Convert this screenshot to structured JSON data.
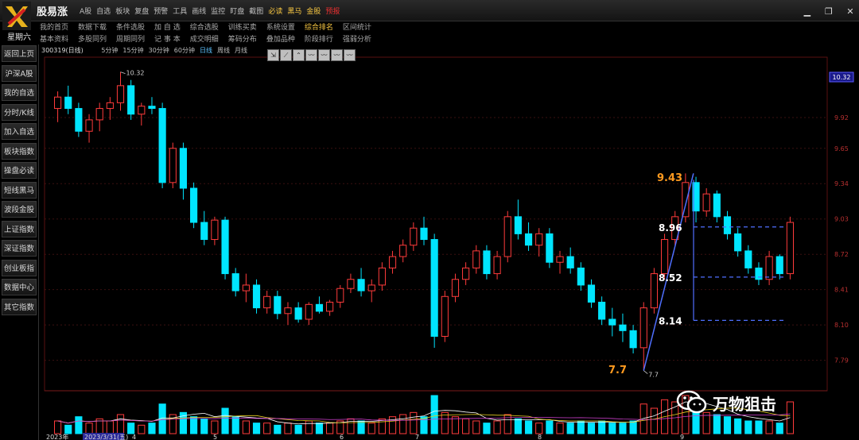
{
  "app": {
    "title": "股易涨",
    "top_menu": [
      "A股",
      "自选",
      "板块",
      "复盘",
      "预警",
      "工具",
      "画线",
      "监控",
      "盯盘",
      "截图",
      "必读",
      "黑马",
      "金股",
      "预报"
    ],
    "top_menu_colors": {
      "必读": "#f5c542",
      "黑马": "#f5c542",
      "金股": "#f5c542",
      "预报": "#e83030"
    },
    "weekday": "星期六",
    "nav_row1": [
      "我的首页",
      "数据下载",
      "条件选股",
      "加 自 选",
      "综合选股",
      "训练买卖",
      "系统设置",
      "综合排名",
      "区间统计"
    ],
    "nav_row2": [
      "基本资料",
      "多股同列",
      "周期同列",
      "记 事 本",
      "成交明细",
      "筹码分布",
      "叠加品种",
      "阶段排行",
      "强弱分析"
    ],
    "nav_highlight": "综合排名"
  },
  "sidebar": {
    "items": [
      "返回上页",
      "沪深A股",
      "我的自选",
      "分时/K线",
      "加入自选",
      "板块指数",
      "操盘必读",
      "短线黑马",
      "波段金股",
      "上证指数",
      "深证指数",
      "创业板指",
      "数据中心",
      "其它指数"
    ]
  },
  "chart_header": {
    "stock_code": "300319(日线)",
    "periods": [
      "5分钟",
      "15分钟",
      "30分钟",
      "60分钟",
      "日线",
      "周线",
      "月线"
    ],
    "active_period": "日线"
  },
  "tools": [
    "cursor-tool",
    "line-tool",
    "segment-tool",
    "wave-tool-1",
    "wave-tool-2",
    "wave-tool-3",
    "wave-tool-4"
  ],
  "watermark": {
    "text": "万物狙击",
    "icon": "wechat-icon"
  },
  "colors": {
    "up": "#ff3b3b",
    "down": "#00e5ff",
    "accent": "#ff9a1f",
    "annot": "#4f6fff",
    "grid": "#3a1010"
  },
  "chart_data": {
    "type": "candlestick",
    "y_axis": {
      "ticks": [
        "9.92",
        "9.65",
        "9.34",
        "9.03",
        "8.72",
        "8.41",
        "8.10",
        "7.79"
      ],
      "current_price": "10.32",
      "range": [
        7.62,
        10.45
      ]
    },
    "x_axis": {
      "labels": [
        "2023年",
        "2023/3/31(五)",
        "4",
        "5",
        "6",
        "7",
        "8",
        "9"
      ]
    },
    "annotations": {
      "high_label": "10.32",
      "low_label": "7.7",
      "low_big": "7.7",
      "target_top": "9.43",
      "levels": [
        "8.96",
        "8.52",
        "8.14"
      ]
    },
    "ohlc": [
      [
        10.0,
        10.15,
        9.88,
        10.1
      ],
      [
        10.1,
        10.2,
        9.95,
        10.0
      ],
      [
        10.0,
        10.05,
        9.75,
        9.8
      ],
      [
        9.8,
        9.95,
        9.7,
        9.9
      ],
      [
        9.9,
        10.05,
        9.8,
        10.0
      ],
      [
        10.0,
        10.1,
        9.9,
        10.05
      ],
      [
        10.05,
        10.32,
        9.98,
        10.2
      ],
      [
        10.2,
        10.25,
        9.9,
        9.95
      ],
      [
        9.95,
        10.05,
        9.85,
        10.02
      ],
      [
        10.02,
        10.1,
        9.95,
        10.0
      ],
      [
        10.0,
        10.05,
        9.3,
        9.35
      ],
      [
        9.35,
        9.7,
        9.3,
        9.65
      ],
      [
        9.65,
        9.7,
        9.2,
        9.3
      ],
      [
        9.3,
        9.35,
        8.95,
        9.0
      ],
      [
        9.0,
        9.1,
        8.8,
        8.85
      ],
      [
        8.85,
        9.05,
        8.8,
        9.02
      ],
      [
        9.02,
        9.05,
        8.5,
        8.55
      ],
      [
        8.55,
        8.6,
        8.35,
        8.4
      ],
      [
        8.4,
        8.55,
        8.3,
        8.45
      ],
      [
        8.45,
        8.5,
        8.2,
        8.25
      ],
      [
        8.25,
        8.4,
        8.2,
        8.35
      ],
      [
        8.35,
        8.4,
        8.15,
        8.2
      ],
      [
        8.2,
        8.3,
        8.1,
        8.25
      ],
      [
        8.25,
        8.3,
        8.12,
        8.15
      ],
      [
        8.15,
        8.3,
        8.1,
        8.28
      ],
      [
        8.28,
        8.35,
        8.2,
        8.22
      ],
      [
        8.22,
        8.32,
        8.18,
        8.3
      ],
      [
        8.3,
        8.45,
        8.25,
        8.42
      ],
      [
        8.42,
        8.55,
        8.38,
        8.5
      ],
      [
        8.5,
        8.6,
        8.35,
        8.4
      ],
      [
        8.4,
        8.5,
        8.3,
        8.45
      ],
      [
        8.45,
        8.65,
        8.4,
        8.6
      ],
      [
        8.6,
        8.75,
        8.55,
        8.7
      ],
      [
        8.7,
        8.85,
        8.65,
        8.8
      ],
      [
        8.8,
        9.0,
        8.75,
        8.95
      ],
      [
        8.95,
        9.05,
        8.8,
        8.85
      ],
      [
        8.85,
        8.9,
        7.9,
        8.0
      ],
      [
        8.0,
        8.4,
        7.95,
        8.35
      ],
      [
        8.35,
        8.55,
        8.3,
        8.5
      ],
      [
        8.5,
        8.65,
        8.45,
        8.6
      ],
      [
        8.6,
        8.8,
        8.55,
        8.75
      ],
      [
        8.75,
        8.8,
        8.5,
        8.55
      ],
      [
        8.55,
        8.75,
        8.5,
        8.7
      ],
      [
        8.7,
        9.1,
        8.65,
        9.05
      ],
      [
        9.05,
        9.2,
        8.85,
        8.9
      ],
      [
        8.9,
        9.0,
        8.75,
        8.8
      ],
      [
        8.8,
        8.95,
        8.7,
        8.9
      ],
      [
        8.9,
        8.95,
        8.6,
        8.65
      ],
      [
        8.65,
        8.75,
        8.55,
        8.7
      ],
      [
        8.7,
        8.78,
        8.55,
        8.6
      ],
      [
        8.6,
        8.65,
        8.4,
        8.45
      ],
      [
        8.45,
        8.5,
        8.25,
        8.3
      ],
      [
        8.3,
        8.35,
        8.1,
        8.15
      ],
      [
        8.15,
        8.25,
        8.0,
        8.1
      ],
      [
        8.1,
        8.2,
        7.95,
        8.05
      ],
      [
        8.05,
        8.1,
        7.85,
        7.9
      ],
      [
        7.9,
        8.3,
        7.7,
        8.25
      ],
      [
        8.25,
        8.6,
        8.2,
        8.55
      ],
      [
        8.55,
        8.9,
        8.5,
        8.85
      ],
      [
        8.85,
        9.1,
        8.8,
        9.05
      ],
      [
        9.05,
        9.43,
        9.0,
        9.35
      ],
      [
        9.35,
        9.4,
        9.0,
        9.1
      ],
      [
        9.1,
        9.3,
        9.05,
        9.25
      ],
      [
        9.25,
        9.28,
        9.0,
        9.05
      ],
      [
        9.05,
        9.1,
        8.85,
        8.9
      ],
      [
        8.9,
        8.95,
        8.7,
        8.75
      ],
      [
        8.75,
        8.8,
        8.55,
        8.6
      ],
      [
        8.6,
        8.65,
        8.45,
        8.5
      ],
      [
        8.5,
        8.75,
        8.45,
        8.7
      ],
      [
        8.7,
        8.72,
        8.5,
        8.55
      ],
      [
        8.55,
        9.05,
        8.5,
        9.0
      ]
    ],
    "volume": [
      6,
      4,
      8,
      5,
      7,
      6,
      9,
      5,
      4,
      5,
      14,
      9,
      10,
      8,
      7,
      6,
      12,
      8,
      6,
      5,
      5,
      4,
      5,
      4,
      6,
      5,
      5,
      6,
      7,
      6,
      5,
      7,
      8,
      9,
      10,
      8,
      18,
      10,
      8,
      7,
      6,
      5,
      6,
      9,
      7,
      6,
      5,
      6,
      5,
      5,
      6,
      5,
      6,
      5,
      5,
      6,
      14,
      12,
      16,
      15,
      18,
      12,
      10,
      9,
      8,
      7,
      6,
      6,
      6,
      5,
      15
    ]
  }
}
